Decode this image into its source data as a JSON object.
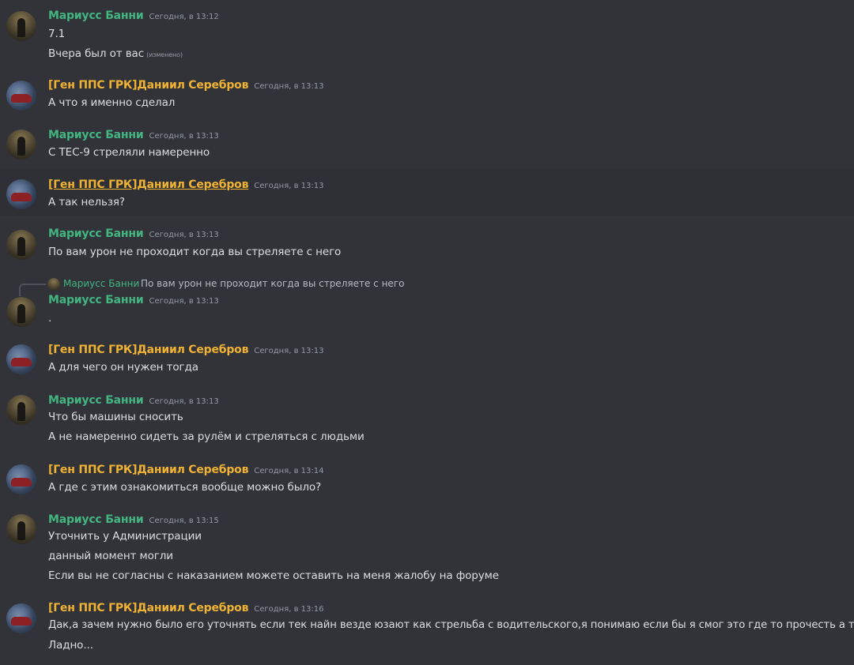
{
  "users": {
    "marius": "Мариусс Банни",
    "daniil": "[Ген ППС ГРК]Даниил Серебров"
  },
  "messages": [
    {
      "ts": "Сегодня, в 13:12",
      "lines": [
        "7.1",
        "Вчера был от вас"
      ],
      "edited": "(изменено)"
    },
    {
      "ts": "Сегодня, в 13:13",
      "lines": [
        "А что я именно сделал"
      ]
    },
    {
      "ts": "Сегодня, в 13:13",
      "lines": [
        "С TEC-9 стреляли намеренно"
      ]
    },
    {
      "ts": "Сегодня, в 13:13",
      "lines": [
        "А так нельзя?"
      ]
    },
    {
      "ts": "Сегодня, в 13:13",
      "lines": [
        "По вам урон не проходит когда вы стреляете с него"
      ]
    },
    {
      "ts": "Сегодня, в 13:13",
      "lines": [
        "."
      ],
      "reply": {
        "name": "Мариусс Банни",
        "text": "По вам урон не проходит когда вы стреляете с него"
      }
    },
    {
      "ts": "Сегодня, в 13:13",
      "lines": [
        "А для чего он нужен тогда"
      ]
    },
    {
      "ts": "Сегодня, в 13:13",
      "lines": [
        "Что бы машины сносить",
        "А не намеренно сидеть за рулём и стреляться с людьми"
      ]
    },
    {
      "ts": "Сегодня, в 13:14",
      "lines": [
        "А где с этим ознакомиться вообще можно было?"
      ]
    },
    {
      "ts": "Сегодня, в 13:15",
      "lines": [
        "Уточнить у Администрации",
        "данный момент могли",
        "Если вы не согласны с наказанием можете оставить на меня жалобу на форуме"
      ]
    },
    {
      "ts": "Сегодня, в 13:16",
      "lines": [
        "Дак,а зачем нужно было его уточнять если тек найн везде юзают как стрельба с водительского,я понимаю если бы я смог это где то прочесть а так",
        "Ладно..."
      ]
    }
  ],
  "colors": {
    "background": "#313338",
    "marius_name": "#43b581",
    "daniil_name": "#f0b232",
    "text": "#dbdee1",
    "timestamp": "#949ba4"
  },
  "icons": {
    "marius_avatar": "avatar-marius-icon",
    "daniil_avatar": "avatar-daniil-icon"
  }
}
